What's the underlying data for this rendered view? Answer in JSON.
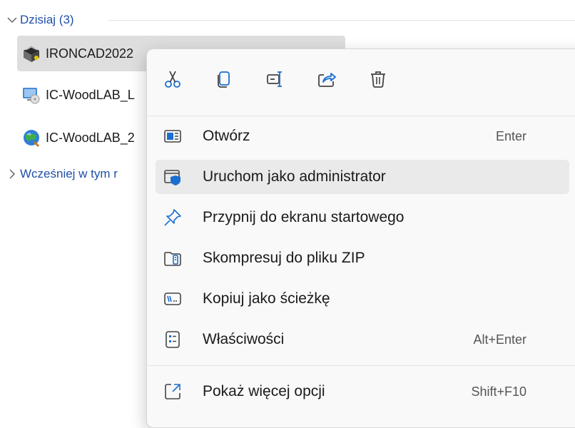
{
  "groups": {
    "today": "Dzisiaj (3)",
    "earlier": "Wcześniej w tym r"
  },
  "files": [
    {
      "name": "IRONCAD2022"
    },
    {
      "name": "IC-WoodLAB_L"
    },
    {
      "name": "IC-WoodLAB_2"
    }
  ],
  "menu": {
    "items": [
      {
        "label": "Otwórz",
        "shortcut": "Enter"
      },
      {
        "label": "Uruchom jako administrator",
        "shortcut": ""
      },
      {
        "label": "Przypnij do ekranu startowego",
        "shortcut": ""
      },
      {
        "label": "Skompresuj do pliku ZIP",
        "shortcut": ""
      },
      {
        "label": "Kopiuj jako ścieżkę",
        "shortcut": ""
      },
      {
        "label": "Właściwości",
        "shortcut": "Alt+Enter"
      },
      {
        "label": "Pokaż więcej opcji",
        "shortcut": "Shift+F10"
      }
    ]
  },
  "icons": {
    "toolbar": [
      "cut-icon",
      "copy-icon",
      "rename-icon",
      "share-icon",
      "delete-icon"
    ],
    "menu": [
      "open-icon",
      "run-as-admin-icon",
      "pin-icon",
      "zip-icon",
      "copy-path-icon",
      "properties-icon",
      "more-options-icon"
    ]
  },
  "colors": {
    "accent": "#1a6fd0",
    "group_header": "#1f4fa8",
    "selection": "#dedede",
    "hover": "#eaeaea"
  }
}
